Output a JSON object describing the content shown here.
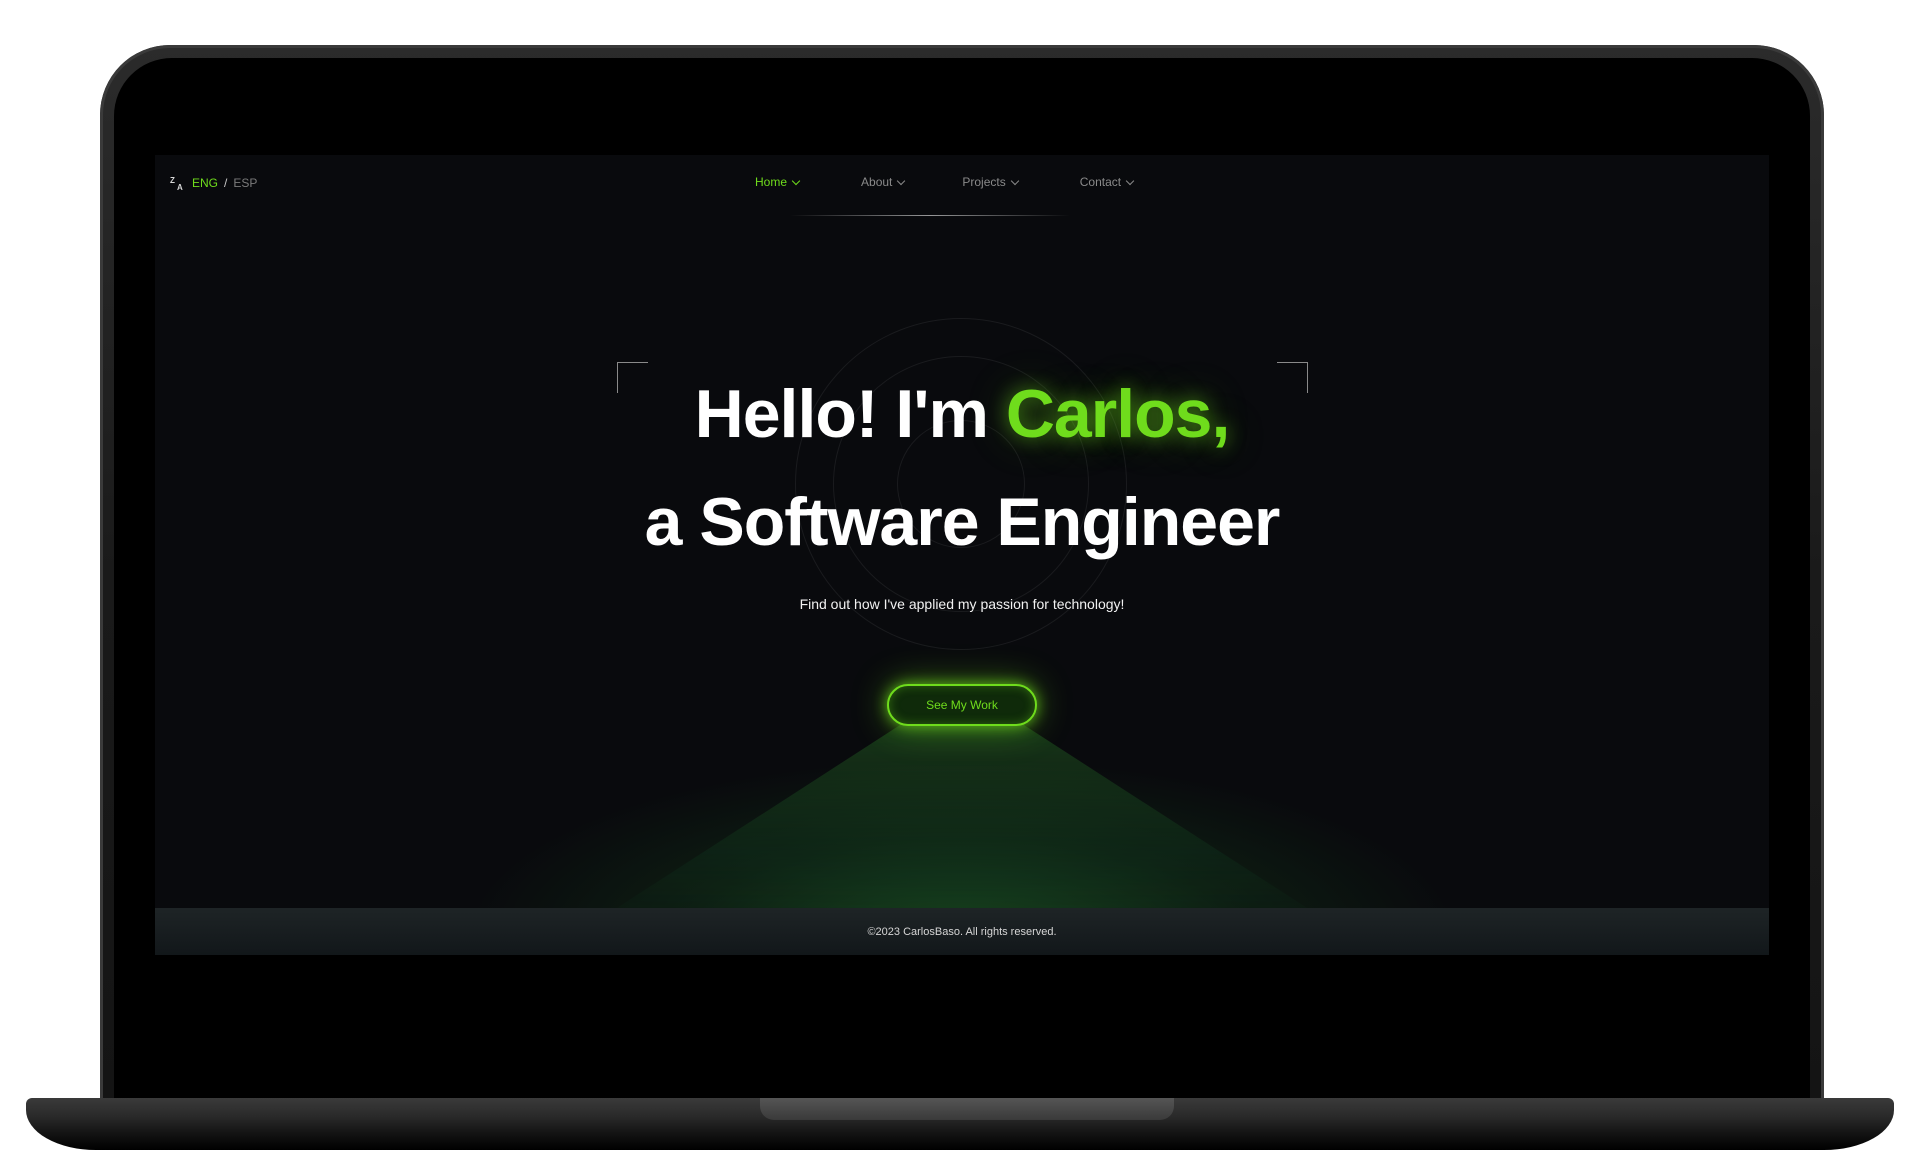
{
  "lang": {
    "icon": "translate-icon",
    "active": "ENG",
    "separator": "/",
    "other": "ESP"
  },
  "nav": {
    "items": [
      {
        "label": "Home",
        "active": true
      },
      {
        "label": "About",
        "active": false
      },
      {
        "label": "Projects",
        "active": false
      },
      {
        "label": "Contact",
        "active": false
      }
    ]
  },
  "hero": {
    "line1_prefix": "Hello! I'm ",
    "name": "Carlos,",
    "line2": "a Software Engineer",
    "subtitle": "Find out how I've applied my passion for technology!",
    "cta_label": "See My Work"
  },
  "footer": {
    "copyright": "©2023 CarlosBaso. All rights reserved."
  },
  "colors": {
    "accent": "#6fdc1c",
    "background": "#090a0d",
    "footer_bg": "#1a2022"
  }
}
